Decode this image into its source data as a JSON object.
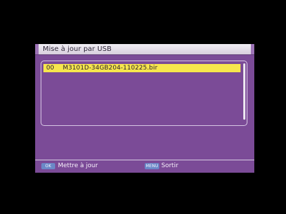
{
  "dialog": {
    "title": "Mise à jour par USB"
  },
  "file_list": {
    "items": [
      {
        "number": "00",
        "name": "M3101D-34GB204-110225.bir",
        "selected": true
      }
    ]
  },
  "footer": {
    "ok_key": "OK",
    "ok_label": "Mettre à jour",
    "menu_key": "MENU",
    "menu_label": "Sortir"
  },
  "colors": {
    "screen_background": "#000000",
    "panel_background": "#7b4b97",
    "title_bar": "#e6dfe9",
    "selection_highlight": "#f6e64d",
    "key_button": "#6b88c7"
  },
  "icons": {
    "ok_key": "ok-key-icon",
    "menu_key": "menu-key-icon"
  }
}
